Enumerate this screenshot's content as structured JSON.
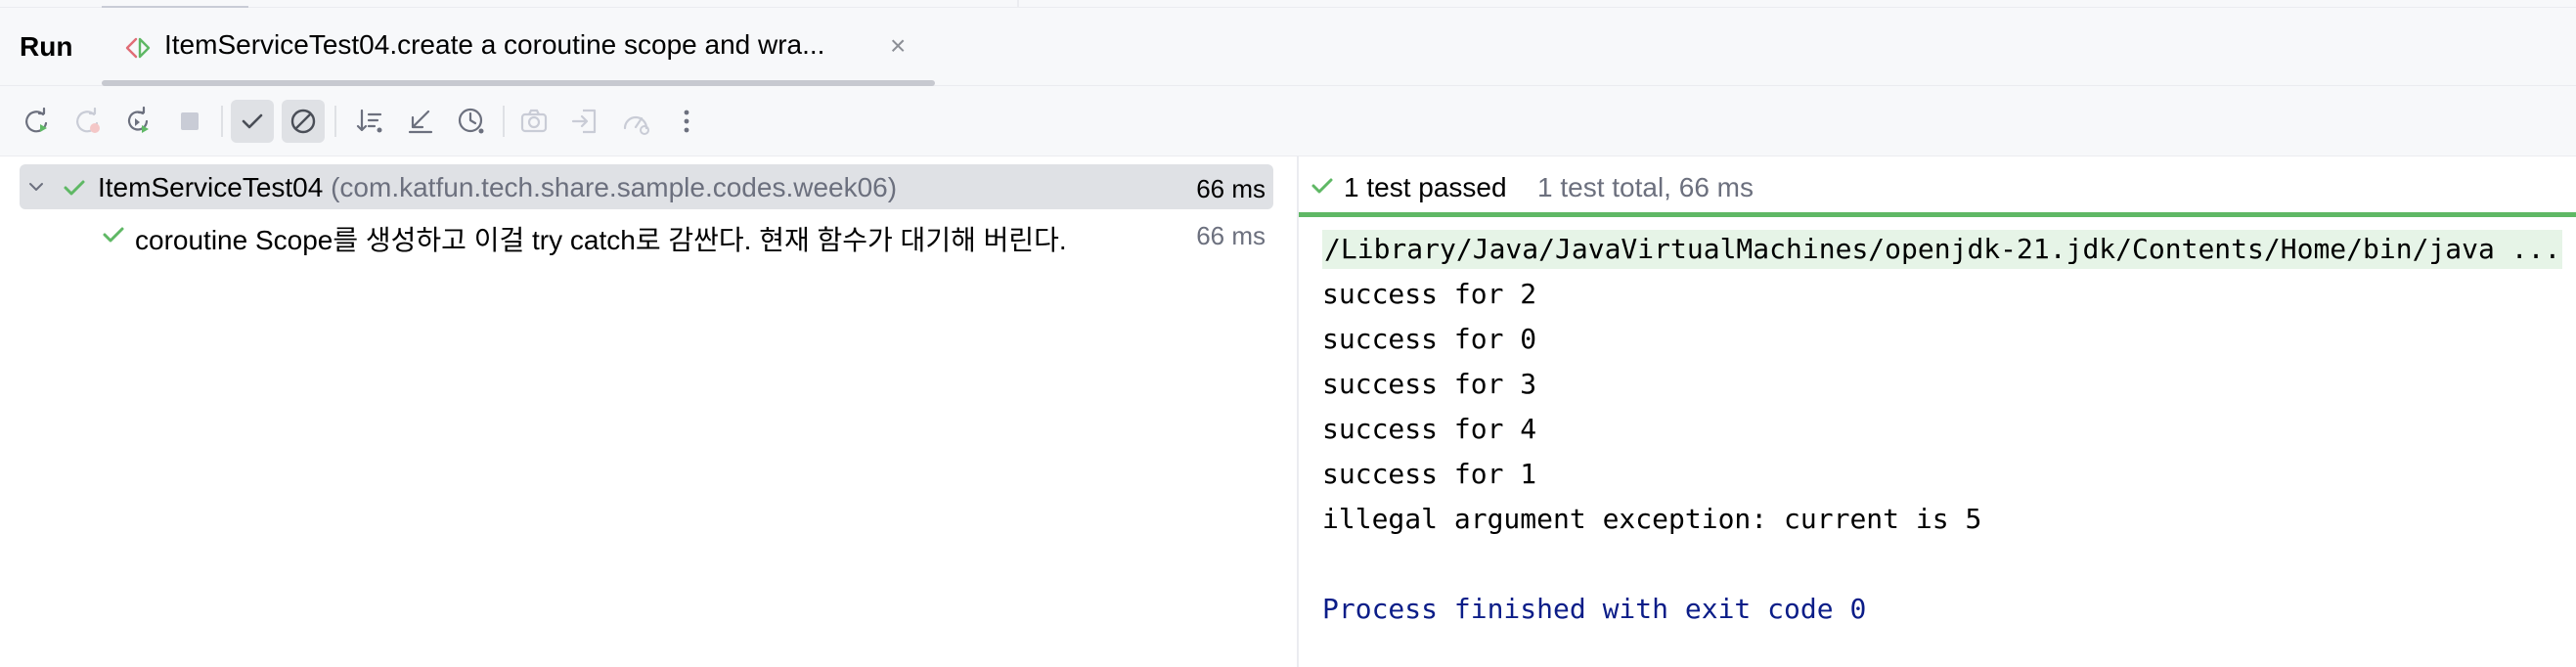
{
  "window": {
    "panel_title": "Run",
    "tab": {
      "label": "ItemServiceTest04.create a coroutine scope and wra...",
      "close_glyph": "×",
      "icon": "test-diff-icon"
    }
  },
  "toolbar": {
    "buttons": [
      {
        "name": "rerun-button",
        "icon": "rerun-icon",
        "enabled": true
      },
      {
        "name": "rerun-failed-button",
        "icon": "rerun-failed-icon",
        "enabled": false
      },
      {
        "name": "toggle-auto-test-button",
        "icon": "auto-rerun-icon",
        "enabled": true
      },
      {
        "name": "stop-button",
        "icon": "stop-icon",
        "enabled": false
      },
      {
        "name": "show-passed-toggle",
        "icon": "check-icon",
        "toggled": true
      },
      {
        "name": "show-ignored-toggle",
        "icon": "ignored-icon",
        "toggled": true
      },
      {
        "name": "sort-alphabetically-button",
        "icon": "sort-icon"
      },
      {
        "name": "collapse-all-button",
        "icon": "collapse-icon"
      },
      {
        "name": "sort-by-duration-button",
        "icon": "clock-icon"
      },
      {
        "name": "screenshot-button",
        "icon": "camera-icon",
        "enabled": false
      },
      {
        "name": "import-tests-button",
        "icon": "import-icon",
        "enabled": false
      },
      {
        "name": "coverage-button",
        "icon": "gauge-icon",
        "enabled": false
      },
      {
        "name": "more-options-button",
        "icon": "more-vertical-icon"
      }
    ]
  },
  "tree": {
    "root": {
      "name": "ItemServiceTest04",
      "package": "(com.katfun.tech.share.sample.codes.week06)",
      "duration": "66 ms",
      "status": "passed"
    },
    "children": [
      {
        "name": "coroutine Scope를 생성하고 이걸 try catch로 감싼다. 현재 함수가 대기해 버린다.",
        "duration": "66 ms",
        "status": "passed"
      }
    ]
  },
  "status": {
    "passed": "1 test passed",
    "total": "1 test total, 66 ms"
  },
  "console": {
    "command": "/Library/Java/JavaVirtualMachines/openjdk-21.jdk/Contents/Home/bin/java ...",
    "lines": [
      "success for 2",
      "success for 0",
      "success for 3",
      "success for 4",
      "success for 1",
      "illegal argument exception: current is 5"
    ],
    "finished": "Process finished with exit code 0"
  },
  "colors": {
    "passed_green": "#5fb865",
    "console_blue": "#0b1d88",
    "selection_gray": "#dfe1e5",
    "muted_text": "#6c707e"
  }
}
